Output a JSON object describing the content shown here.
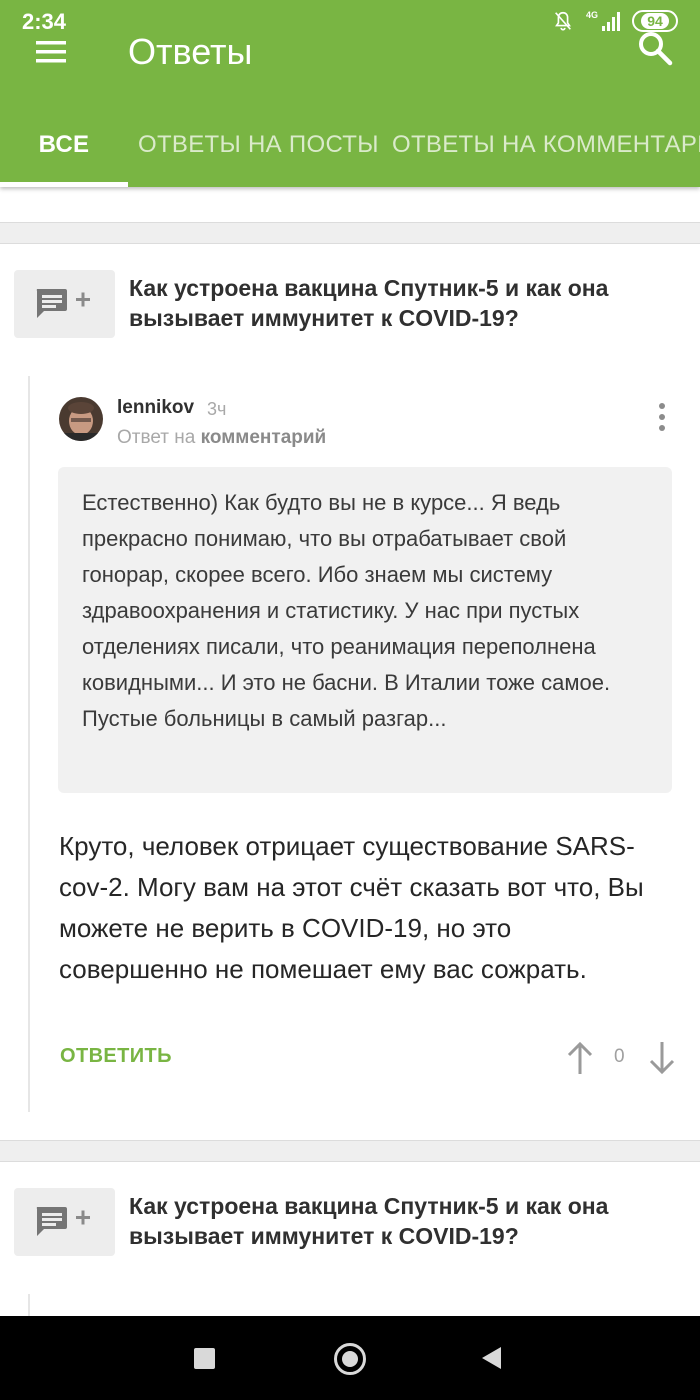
{
  "status_bar": {
    "time": "2:34",
    "network": "4G",
    "battery": "94"
  },
  "toolbar": {
    "title": "Ответы",
    "menu_icon": "hamburger-menu-icon",
    "search_icon": "search-icon"
  },
  "tabs": [
    {
      "label": "ВСЕ",
      "active": true
    },
    {
      "label": "ОТВЕТЫ НА ПОСТЫ",
      "active": false
    },
    {
      "label": "ОТВЕТЫ НА КОММЕНТАРИИ",
      "active": false
    }
  ],
  "feed": [
    {
      "post_title": "Как устроена вакцина Спутник-5 и как она вызывает иммунитет к COVID-19?",
      "comment": {
        "author": "lennikov",
        "time": "3ч",
        "reply_prefix": "Ответ на",
        "reply_target": "комментарий",
        "quoted_text": "Естественно) Как будто вы не в курсе... Я ведь прекрасно понимаю, что вы отрабатывает свой гонорар, скорее всего. Ибо знаем мы систему здравоохранения и статистику. У нас при пустых отделениях писали, что реанимация переполнена ковидными... И это не басни. В Италии тоже самое. Пустые больницы в самый разгар...",
        "text": "Круто, человек отрицает существование SARS-cov-2. Могу вам на этот счёт сказать вот что, Вы можете не верить в COVID-19, но это совершенно не помешает ему вас сожрать.",
        "reply_label": "ОТВЕТИТЬ",
        "votes": "0"
      }
    },
    {
      "post_title": "Как устроена вакцина Спутник-5 и как она вызывает иммунитет к COVID-19?"
    }
  ],
  "colors": {
    "accent": "#79b543",
    "background": "#ffffff",
    "separator": "#efefef"
  }
}
